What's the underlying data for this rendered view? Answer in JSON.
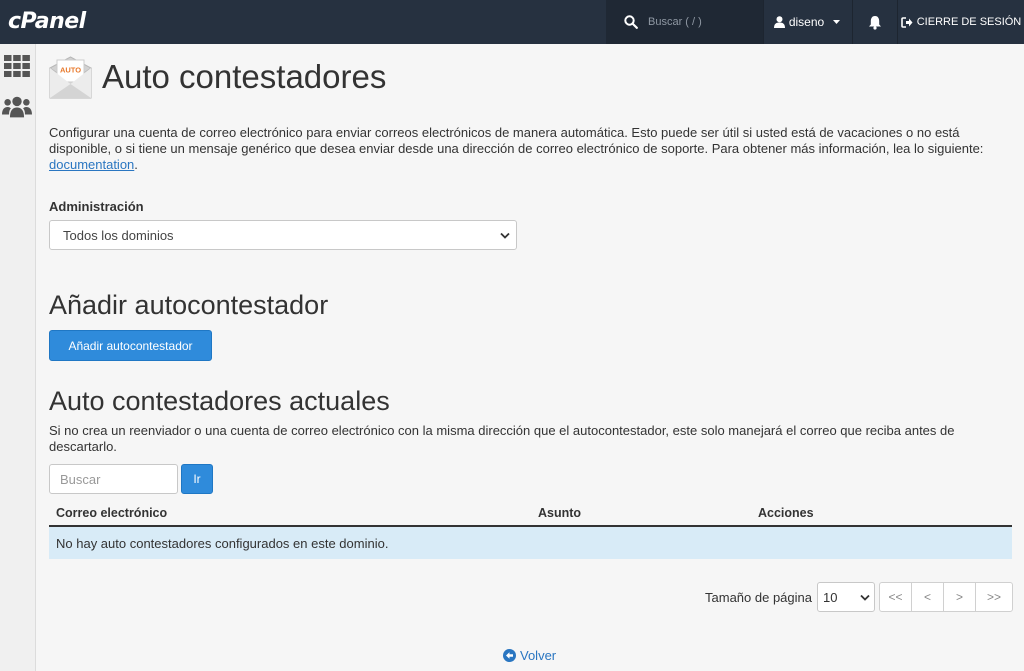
{
  "topbar": {
    "logo": "cPanel",
    "search_placeholder": "Buscar ( / )",
    "user": "diseno",
    "logout": "CIERRE DE SESIÓN"
  },
  "header": {
    "icon_text": "AUTO",
    "title": "Auto contestadores"
  },
  "intro": {
    "text": "Configurar una cuenta de correo electrónico para enviar correos electrónicos de manera automática. Esto puede ser útil si usted está de vacaciones o no está disponible, o si tiene un mensaje genérico que desea enviar desde una dirección de correo electrónico de soporte. Para obtener más información, lea lo siguiente: ",
    "link": "documentation",
    "after_link": "."
  },
  "admin": {
    "label": "Administración",
    "selected": "Todos los dominios"
  },
  "add_section": {
    "heading": "Añadir autocontestador",
    "button": "Añadir autocontestador"
  },
  "current_section": {
    "heading": "Auto contestadores actuales",
    "description": "Si no crea un reenviador o una cuenta de correo electrónico con la misma dirección que el autocontestador, este solo manejará el correo que reciba antes de descartarlo.",
    "search_placeholder": "Buscar",
    "go_button": "Ir"
  },
  "table": {
    "columns": [
      "Correo electrónico",
      "Asunto",
      "Acciones"
    ],
    "empty_message": "No hay auto contestadores configurados en este dominio."
  },
  "pagination": {
    "label": "Tamaño de página",
    "page_size": "10",
    "buttons": [
      "<<",
      "<",
      ">",
      ">>"
    ]
  },
  "footer": {
    "back": "Volver"
  },
  "colors": {
    "topbar": "#263140",
    "primary": "#2f8bdb",
    "link": "#2a76c1",
    "info_row": "#d8ebf7"
  }
}
